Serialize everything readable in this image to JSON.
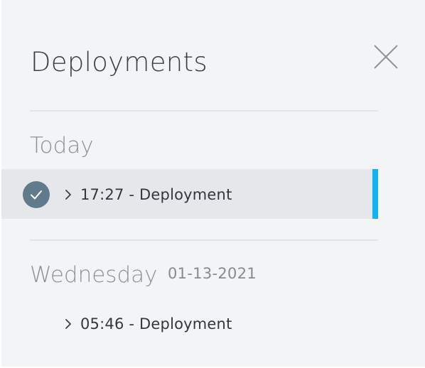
{
  "panel": {
    "title": "Deployments",
    "close_icon": "close-icon"
  },
  "groups": [
    {
      "label": "Today",
      "date": "",
      "items": [
        {
          "label": "17:27 - Deployment",
          "status": "success",
          "selected": true
        }
      ]
    },
    {
      "label": "Wednesday",
      "date": "01-13-2021",
      "items": [
        {
          "label": "05:46 - Deployment",
          "selected": false
        }
      ]
    }
  ],
  "colors": {
    "accent": "#12b3f0",
    "check_bg": "#617a8c",
    "panel_bg": "#f3f4f6",
    "selected_bg": "#e6e7ea"
  }
}
